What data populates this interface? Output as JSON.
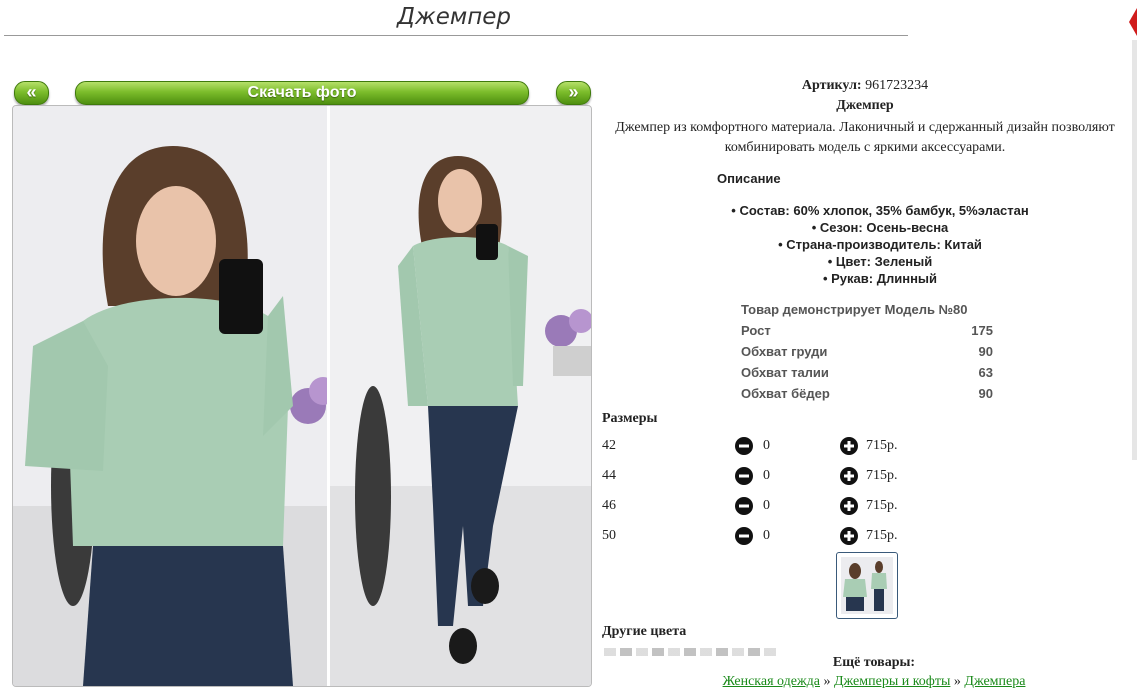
{
  "page": {
    "title": "Джемпер"
  },
  "gallery": {
    "prev_label": "«",
    "next_label": "»",
    "download_label": "Скачать фото"
  },
  "product": {
    "article_label": "Артикул:",
    "article_value": "961723234",
    "name": "Джемпер",
    "description": "Джемпер из комфортного материала. Лаконичный и сдержанный дизайн позволяют комбинировать модель с яркими аксессуарами."
  },
  "details": {
    "heading": "Описание",
    "specs": [
      "Состав: 60% хлопок, 35% бамбук, 5%эластан",
      "Сезон: Осень-весна",
      "Страна-производитель: Китай",
      "Цвет: Зеленый",
      "Рукав: Длинный"
    ]
  },
  "model": {
    "rows": [
      {
        "label": "Товар демонстрирует Модель №80",
        "value": ""
      },
      {
        "label": "Рост",
        "value": "175"
      },
      {
        "label": "Обхват груди",
        "value": "90"
      },
      {
        "label": "Обхват талии",
        "value": "63"
      },
      {
        "label": "Обхват бёдер",
        "value": "90"
      }
    ]
  },
  "sizes": {
    "heading": "Размеры",
    "rows": [
      {
        "size": "42",
        "qty": "0",
        "price": "715р."
      },
      {
        "size": "44",
        "qty": "0",
        "price": "715р."
      },
      {
        "size": "46",
        "qty": "0",
        "price": "715р."
      },
      {
        "size": "50",
        "qty": "0",
        "price": "715р."
      }
    ]
  },
  "other_colors": {
    "heading": "Другие цвета"
  },
  "more": {
    "heading": "Ещё товары:",
    "crumbs": [
      "Женская одежда",
      "Джемперы и кофты",
      "Джемпера"
    ],
    "separator": "»"
  },
  "colors": {
    "button_green": "#7cbd2b",
    "link_green": "#1a8a1a",
    "sweater": "#a9cdb4",
    "jeans": "#27364f",
    "hair": "#5a3e2b"
  },
  "icons": [
    "minus-circle-icon",
    "plus-circle-icon",
    "corner-marker-icon"
  ]
}
